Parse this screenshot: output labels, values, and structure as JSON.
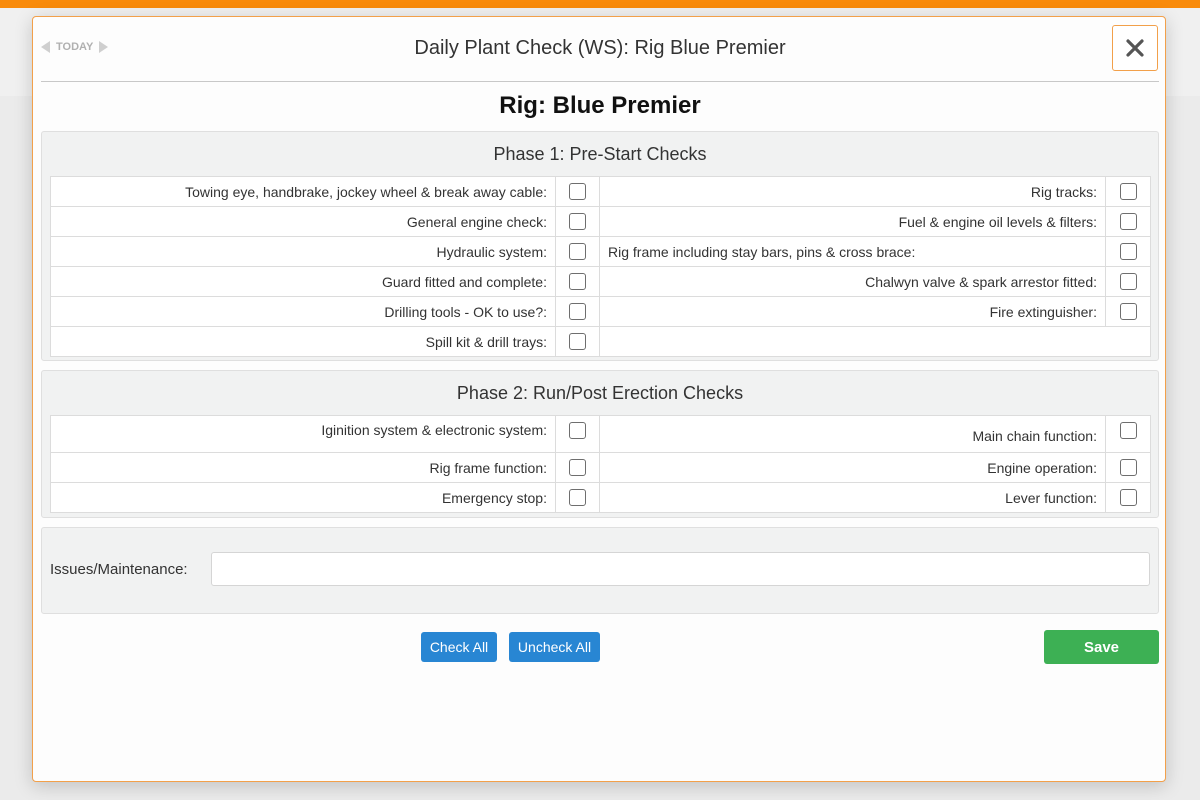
{
  "modal": {
    "title": "Daily Plant Check (WS): Rig Blue Premier",
    "today_label": "TODAY",
    "rig_heading": "Rig: Blue Premier"
  },
  "phase1": {
    "title": "Phase 1: Pre-Start Checks",
    "rows": [
      {
        "left": "Towing eye, handbrake, jockey wheel & break away cable:",
        "right": "Rig tracks:"
      },
      {
        "left": "General engine check:",
        "right": "Fuel & engine oil levels & filters:"
      },
      {
        "left": "Hydraulic system:",
        "right": "Rig frame including stay bars, pins & cross brace:"
      },
      {
        "left": "Guard fitted and complete:",
        "right": "Chalwyn valve & spark arrestor fitted:"
      },
      {
        "left": "Drilling tools - OK to use?:",
        "right": "Fire extinguisher:"
      },
      {
        "left": "Spill kit & drill trays:",
        "right": ""
      }
    ]
  },
  "phase2": {
    "title": "Phase 2: Run/Post Erection Checks",
    "rows": [
      {
        "left": "Iginition system & electronic system:",
        "right": "Main chain function:"
      },
      {
        "left": "Rig frame function:",
        "right": "Engine operation:"
      },
      {
        "left": "Emergency stop:",
        "right": "Lever function:"
      }
    ]
  },
  "issues": {
    "label": "Issues/Maintenance:",
    "value": "",
    "placeholder": ""
  },
  "buttons": {
    "check_all": "Check All",
    "uncheck_all": "Uncheck All",
    "save": "Save"
  },
  "colors": {
    "accent_orange": "#f98b0b",
    "button_blue": "#2886d3",
    "save_green": "#3db054"
  }
}
